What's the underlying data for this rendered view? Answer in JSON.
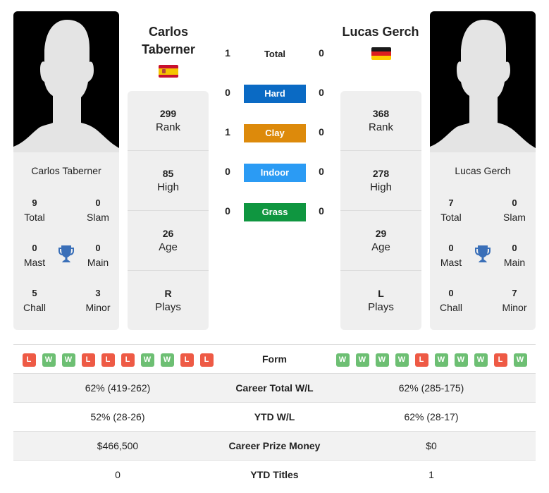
{
  "players": [
    {
      "name": "Carlos Taberner",
      "name_line1": "Carlos",
      "name_line2": "Taberner",
      "country_flag": "spain-flag",
      "stats": {
        "rank": "299",
        "high": "85",
        "age": "26",
        "plays": "R"
      },
      "titles": {
        "total": "9",
        "slam": "0",
        "mast": "0",
        "main": "0",
        "chall": "5",
        "minor": "3"
      },
      "form": [
        "L",
        "W",
        "W",
        "L",
        "L",
        "L",
        "W",
        "W",
        "L",
        "L"
      ],
      "career_wl": "62% (419-262)",
      "ytd_wl": "52% (28-26)",
      "prize_money": "$466,500",
      "ytd_titles": "0"
    },
    {
      "name": "Lucas Gerch",
      "country_flag": "germany-flag",
      "stats": {
        "rank": "368",
        "high": "278",
        "age": "29",
        "plays": "L"
      },
      "titles": {
        "total": "7",
        "slam": "0",
        "mast": "0",
        "main": "0",
        "chall": "0",
        "minor": "7"
      },
      "form": [
        "W",
        "W",
        "W",
        "W",
        "L",
        "W",
        "W",
        "W",
        "L",
        "W"
      ],
      "career_wl": "62% (285-175)",
      "ytd_wl": "62% (28-17)",
      "prize_money": "$0",
      "ytd_titles": "1"
    }
  ],
  "stat_labels": {
    "rank": "Rank",
    "high": "High",
    "age": "Age",
    "plays": "Plays"
  },
  "title_labels": {
    "total": "Total",
    "slam": "Slam",
    "mast": "Mast",
    "main": "Main",
    "chall": "Chall",
    "minor": "Minor"
  },
  "h2h": {
    "total": {
      "label": "Total",
      "p1": "1",
      "p2": "0"
    },
    "surfaces": [
      {
        "label": "Hard",
        "p1": "0",
        "p2": "0",
        "color": "#0a6ac4"
      },
      {
        "label": "Clay",
        "p1": "1",
        "p2": "0",
        "color": "#dd8a0b"
      },
      {
        "label": "Indoor",
        "p1": "0",
        "p2": "0",
        "color": "#2b9bf4"
      },
      {
        "label": "Grass",
        "p1": "0",
        "p2": "0",
        "color": "#0f9640"
      }
    ]
  },
  "table_labels": {
    "form": "Form",
    "career_wl": "Career Total W/L",
    "ytd_wl": "YTD W/L",
    "prize_money": "Career Prize Money",
    "ytd_titles": "YTD Titles"
  },
  "colors": {
    "win": "#6dbf73",
    "loss": "#ee5a45",
    "trophy": "#3a6fb8"
  }
}
